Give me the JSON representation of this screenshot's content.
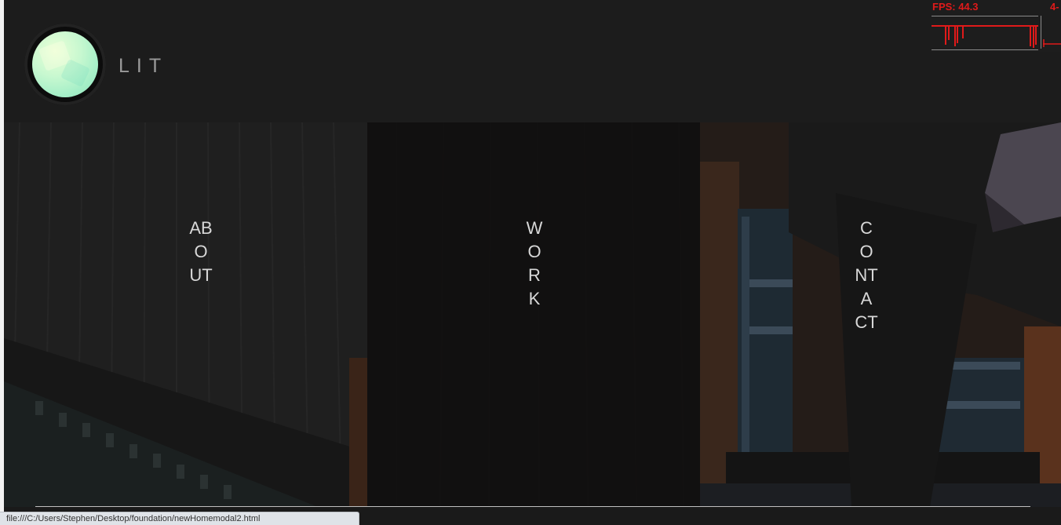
{
  "header": {
    "brand": "LIT"
  },
  "fps_meter": {
    "label": "FPS: 44.3",
    "secondary": "4-",
    "color": "#e01a1a"
  },
  "nav": {
    "panels": [
      {
        "label": "ABOUT"
      },
      {
        "label": "WORK"
      },
      {
        "label": "CONTACT"
      }
    ]
  },
  "statusbar": {
    "url": "file:///C:/Users/Stephen/Desktop/foundation/newHomemodal2.html"
  },
  "colors": {
    "background": "#1a1a1a",
    "logo": "#b8f3cc",
    "label_text": "#d8d8d8"
  }
}
